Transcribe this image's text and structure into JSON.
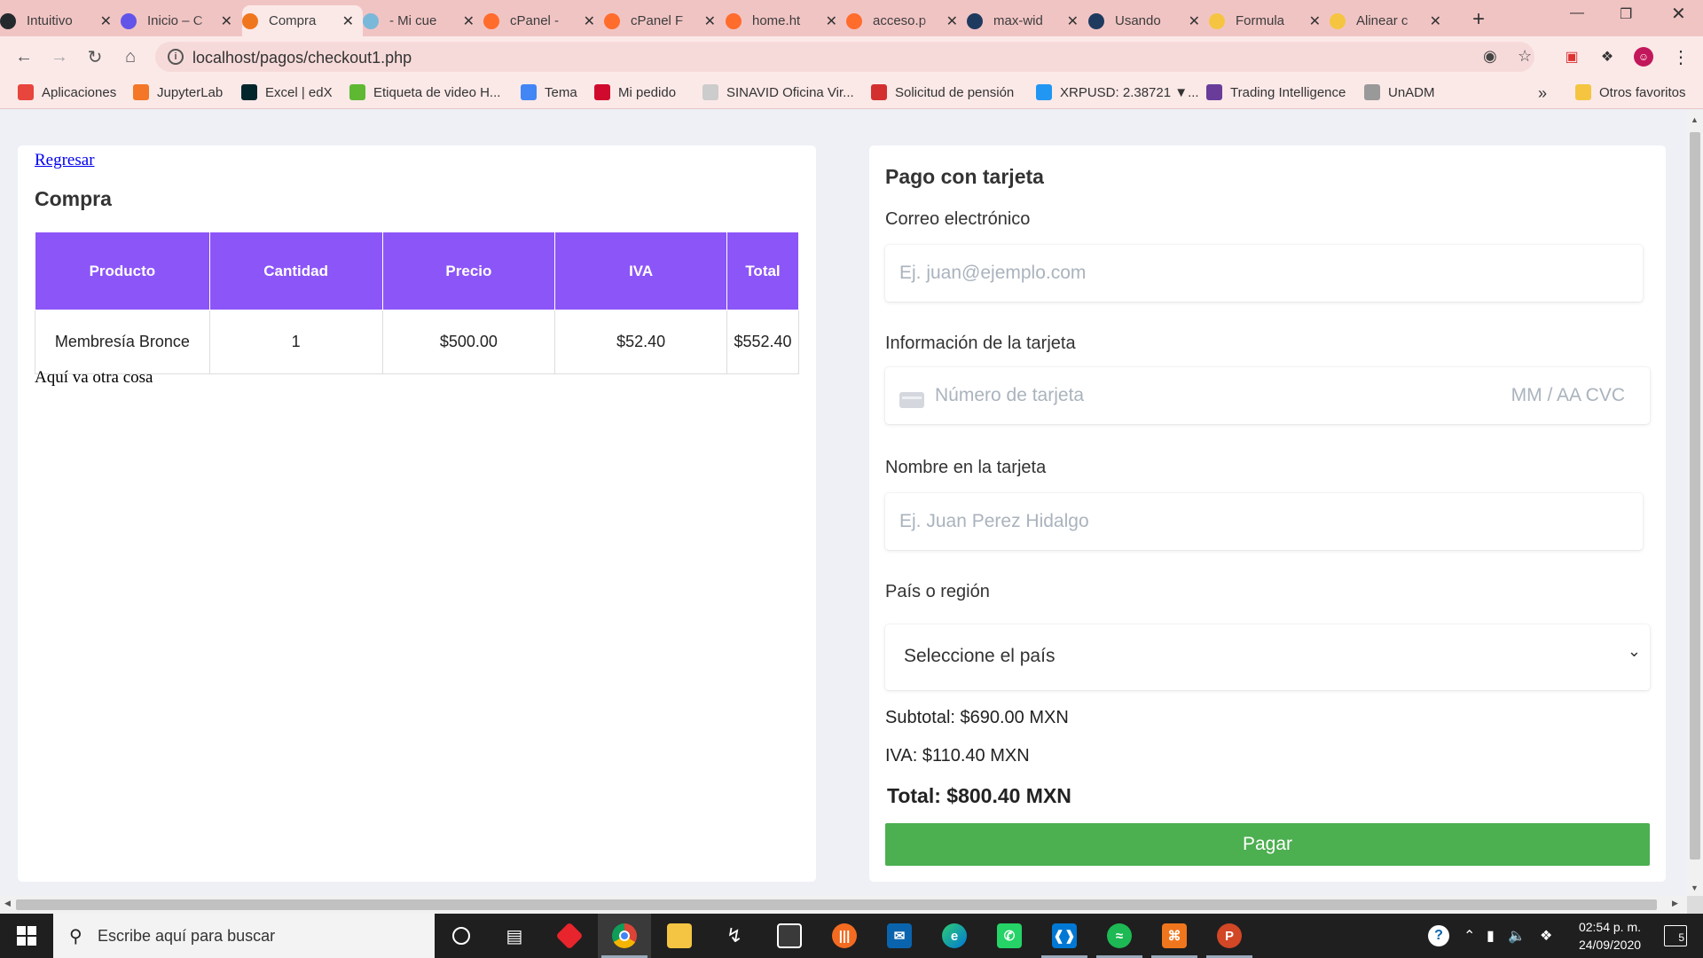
{
  "browser": {
    "tabs": [
      {
        "label": "Intuitivo",
        "icon": "github-icon",
        "color": "#24292e",
        "active": false
      },
      {
        "label": "Inicio – C",
        "icon": "s-logo-icon",
        "color": "#6254e8",
        "active": false
      },
      {
        "label": "Compra",
        "icon": "xampp-icon",
        "color": "#f0761d",
        "active": true
      },
      {
        "label": "- Mi cue",
        "icon": "globe-icon",
        "color": "#7ab8d9",
        "active": false
      },
      {
        "label": "cPanel -",
        "icon": "cpanel-icon",
        "color": "#ff6c2c",
        "active": false
      },
      {
        "label": "cPanel F",
        "icon": "cpanel-icon",
        "color": "#ff6c2c",
        "active": false
      },
      {
        "label": "home.ht",
        "icon": "cpanel-icon",
        "color": "#ff6c2c",
        "active": false
      },
      {
        "label": "acceso.p",
        "icon": "cpanel-icon",
        "color": "#ff6c2c",
        "active": false
      },
      {
        "label": "max-wid",
        "icon": "bird-icon",
        "color": "#1f3a5f",
        "active": false
      },
      {
        "label": "Usando",
        "icon": "bird-icon",
        "color": "#1f3a5f",
        "active": false
      },
      {
        "label": "Formula",
        "icon": "note-icon",
        "color": "#f5c542",
        "active": false
      },
      {
        "label": "Alinear c",
        "icon": "note-icon",
        "color": "#f5c542",
        "active": false
      }
    ],
    "url": "localhost/pagos/checkout1.php",
    "bookmarks": [
      {
        "label": "Aplicaciones",
        "icon": "apps-grid-icon",
        "color": "#e8453c"
      },
      {
        "label": "JupyterLab",
        "icon": "jupyter-icon",
        "color": "#f37726"
      },
      {
        "label": "Excel | edX",
        "icon": "edx-icon",
        "color": "#02262b"
      },
      {
        "label": "Etiqueta de video H...",
        "icon": "video-icon",
        "color": "#5fb832"
      },
      {
        "label": "Tema",
        "icon": "google-icon",
        "color": "#4285f4"
      },
      {
        "label": "Mi pedido",
        "icon": "huawei-icon",
        "color": "#cf0a2c"
      },
      {
        "label": "SINAVID Oficina Vir...",
        "icon": "sinavid-icon",
        "color": "#cccccc"
      },
      {
        "label": "Solicitud de pensión",
        "icon": "red-circle-icon",
        "color": "#d32f2f"
      },
      {
        "label": "XRPUSD: 2.38721 ▼...",
        "icon": "chart-icon",
        "color": "#2196f3"
      },
      {
        "label": "Trading Intelligence",
        "icon": "ti-icon",
        "color": "#6a3c9a"
      },
      {
        "label": "UnADM",
        "icon": "unadm-icon",
        "color": "#999999"
      }
    ],
    "other_bookmarks": "Otros favoritos"
  },
  "purchase": {
    "back_link": "Regresar",
    "title": "Compra",
    "table": {
      "headers": [
        "Producto",
        "Cantidad",
        "Precio",
        "IVA",
        "Total"
      ],
      "rows": [
        [
          "Membresía Bronce",
          "1",
          "$500.00",
          "$52.40",
          "$552.40"
        ]
      ]
    },
    "note": "Aquí va otra cosa",
    "header_color": "#8c55f8"
  },
  "payment": {
    "title": "Pago con tarjeta",
    "email_label": "Correo electrónico",
    "email_placeholder": "Ej. juan@ejemplo.com",
    "card_label": "Información de la tarjeta",
    "card_placeholder": "Número de tarjeta",
    "card_extra": "MM / AA  CVC",
    "name_label": "Nombre en la tarjeta",
    "name_placeholder": "Ej. Juan Perez Hidalgo",
    "country_label": "País o región",
    "country_selected": "Seleccione el país",
    "subtotal": "Subtotal: $690.00 MXN",
    "iva": "IVA: $110.40 MXN",
    "total": "Total: $800.40 MXN",
    "pay_button": "Pagar",
    "button_color": "#4caf50"
  },
  "taskbar": {
    "search_placeholder": "Escribe aquí para buscar",
    "time": "02:54 p. m.",
    "date": "24/09/2020",
    "notifications": "5"
  }
}
